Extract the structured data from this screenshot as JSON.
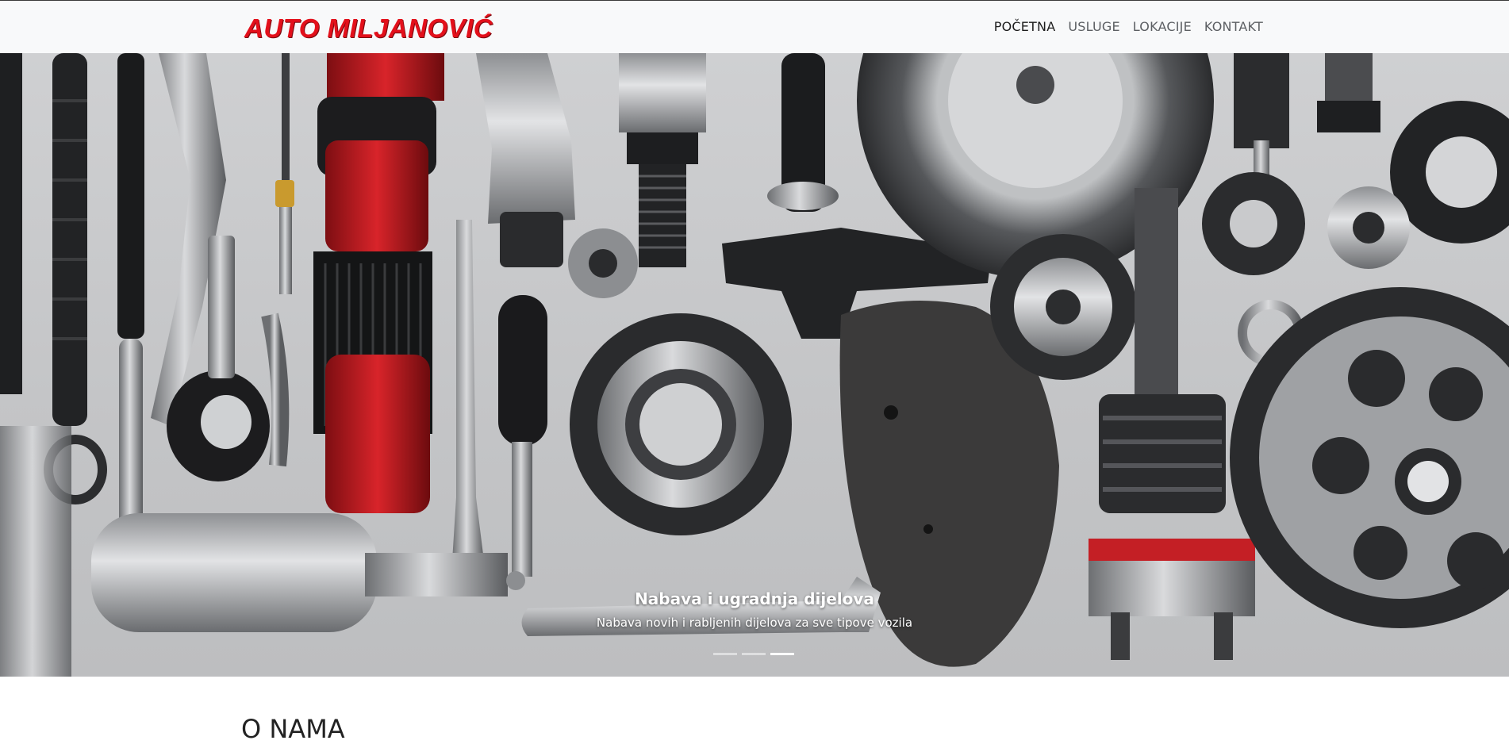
{
  "brand": {
    "name": "AUTO MILJANOVIĆ",
    "color": "#e3101b"
  },
  "nav": {
    "items": [
      {
        "label": "POČETNA",
        "active": true
      },
      {
        "label": "USLUGE",
        "active": false
      },
      {
        "label": "LOKACIJE",
        "active": false
      },
      {
        "label": "KONTAKT",
        "active": false
      }
    ]
  },
  "carousel": {
    "image_subject": "car-parts-flatlay",
    "caption_title": "Nabava i ugradnja dijelova",
    "caption_text": "Nabava novih i rabljenih dijelova za sve tipove vozila",
    "slide_count": 3,
    "active_slide": 3
  },
  "about": {
    "heading": "O NAMA"
  }
}
